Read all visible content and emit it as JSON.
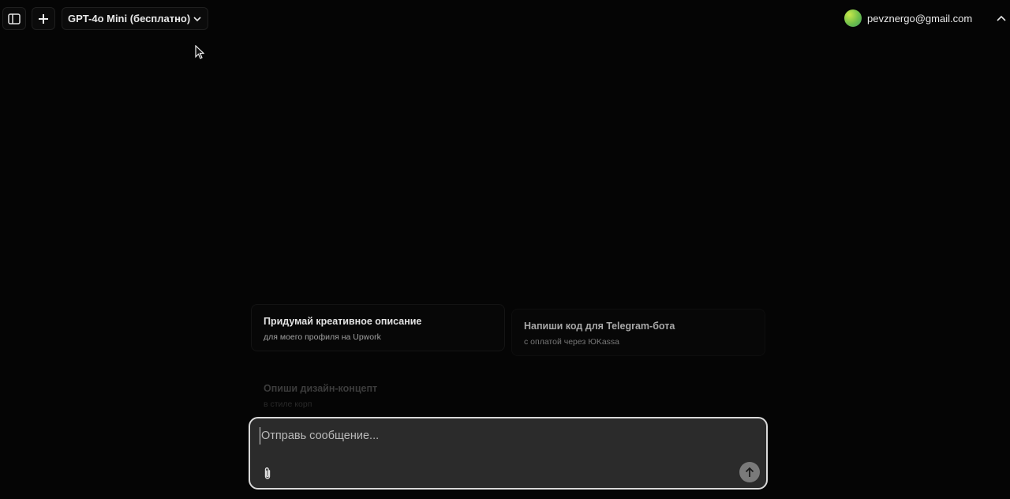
{
  "header": {
    "sidebar_toggle_icon": "sidebar-panel-icon",
    "new_chat_icon": "plus-icon",
    "model_selector": {
      "label": "GPT-4o Mini (бесплатно)",
      "icon": "chevron-down-icon"
    },
    "account": {
      "email": "pevznergo@gmail.com",
      "avatar_colors": [
        "#c8e84a",
        "#3f9e63"
      ]
    },
    "collapse_icon": "chevron-up-icon"
  },
  "suggestions": [
    {
      "title": "Придумай креативное описание",
      "subtitle": "для моего профиля на Upwork"
    },
    {
      "title": "Напиши код для Telegram-бота",
      "subtitle": "с оплатой через ЮKassa"
    },
    {
      "title": "Опиши дизайн-концепт",
      "subtitle": "в стиле корп"
    }
  ],
  "composer": {
    "placeholder": "Отправь сообщение...",
    "value": "",
    "attach_icon": "paperclip-icon",
    "send_icon": "arrow-up-icon"
  },
  "colors": {
    "background": "#050505",
    "composer_bg": "#2b2b2b",
    "composer_border": "#d9d9d9",
    "send_button": "#7a7a7a"
  }
}
